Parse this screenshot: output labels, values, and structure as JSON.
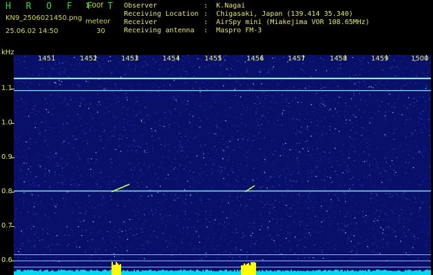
{
  "header": {
    "brand": "H R O F F T",
    "version": "1.00f",
    "filename": "KN9_2506021450.png",
    "category": "meteor",
    "datetime": "25.06.02 14:50",
    "count": "30",
    "info": [
      {
        "label": "Observer",
        "value": ":  K.Nagai"
      },
      {
        "label": "Receiving Location",
        "value": ":  Chigasaki, Japan (139.414 35.340)"
      },
      {
        "label": "Receiver",
        "value": ":  AirSpy mini (Miakejima VOR 108.65MHz)"
      },
      {
        "label": "Receiving antenna",
        "value": ":  Maspro FM-3"
      }
    ]
  },
  "plot": {
    "y_unit": "kHz",
    "x_ticks": [
      "1451",
      "1452",
      "1453",
      "1454",
      "1455",
      "1456",
      "1457",
      "1458",
      "1459",
      "1500"
    ],
    "y_ticks": [
      "1.1",
      "1.0",
      "0.9",
      "0.8",
      "0.7",
      "0.6"
    ],
    "colors": {
      "background": "#08106a",
      "signal": "#7fe0f0",
      "meteor": "#d8ff4a",
      "spectrum": "#00d8f0",
      "peak": "#ffff00"
    }
  }
}
